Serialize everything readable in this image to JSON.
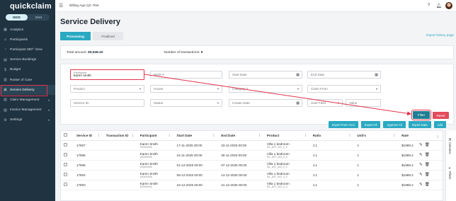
{
  "sidebar": {
    "brand": "quickclaim",
    "toggle": [
      "NDIS",
      "SAH"
    ],
    "items": [
      {
        "label": "Analytics",
        "icon": "analytics-icon",
        "glyph": "▦"
      },
      {
        "label": "Participants",
        "icon": "participants-icon",
        "glyph": "☺"
      },
      {
        "label": "Participant 360° View",
        "icon": "participant-360-icon",
        "glyph": "◔"
      },
      {
        "label": "Service Bookings",
        "icon": "bookings-icon",
        "glyph": "▤"
      },
      {
        "label": "Budget",
        "icon": "budget-icon",
        "glyph": "$"
      },
      {
        "label": "Roster of Care",
        "icon": "roster-icon",
        "glyph": "▥"
      },
      {
        "label": "Service Delivery",
        "icon": "service-delivery-icon",
        "glyph": "▣"
      },
      {
        "label": "Claim Management",
        "icon": "claim-icon",
        "glyph": "▧"
      },
      {
        "label": "Invoice Management",
        "icon": "invoice-icon",
        "glyph": "▨"
      },
      {
        "label": "Settings",
        "icon": "settings-icon",
        "glyph": "⚙"
      }
    ]
  },
  "topbar": {
    "app_title": "Billing App QC-Test"
  },
  "page": {
    "title": "Service Delivery",
    "tabs": [
      "Processing",
      "Finalized"
    ],
    "export_link": "Import history page"
  },
  "summary": {
    "total_label": "Total amount:",
    "total_value": "$9,948.40",
    "count_label": "Number of transactions:",
    "count_value": "5"
  },
  "filters": {
    "participant_label": "Participant",
    "participant_value": "karen smith",
    "ndis_placeholder": "NDIS #",
    "start_date": "Start Date",
    "end_date": "End Date",
    "product": "Product",
    "house": "House",
    "category": "Category 7",
    "claim_from": "Claim From",
    "service_id": "Service ID",
    "status": "Status",
    "create_date": "Create Date",
    "user_field": "User Field",
    "value": "Value",
    "filter_btn": "Filter",
    "reset_btn": "Reset"
  },
  "actions": [
    "Import From XLS",
    "Export All",
    "Approve All",
    "Import Data",
    "Add"
  ],
  "table": {
    "columns": [
      "Service ID",
      "Transaction ID",
      "Participant",
      "Start Date",
      "End Date",
      "Product",
      "Ratio",
      "Unit's",
      "Rate"
    ],
    "rows": [
      {
        "service_id": "17807",
        "transaction_id": "",
        "participant": "Karen Smith",
        "participant_sub": "430000006",
        "start": "17-11-2025 00:00",
        "end": "23-11-2025 00:00",
        "product": "Villa 1 bedroom",
        "product_sub": "SIL_AST_002_0_3",
        "ratio": "1:1",
        "units": "1",
        "rate": "$1989.2"
      },
      {
        "service_id": "17806",
        "transaction_id": "",
        "participant": "Karen Smith",
        "participant_sub": "430000006",
        "start": "24-11-2025 00:00",
        "end": "30-11-2025 00:00",
        "product": "Villa 1 bedroom",
        "product_sub": "SIL_AST_002_0_3",
        "ratio": "1:1",
        "units": "1",
        "rate": "$1989.2"
      },
      {
        "service_id": "17805",
        "transaction_id": "",
        "participant": "Karen Smith",
        "participant_sub": "430000006",
        "start": "01-12-2025 00:00",
        "end": "07-12-2025 00:00",
        "product": "Villa 1 bedroom",
        "product_sub": "SIL_AST_002_0_3",
        "ratio": "1:1",
        "units": "1",
        "rate": "$1989.2"
      },
      {
        "service_id": "17804",
        "transaction_id": "",
        "participant": "Karen Smith",
        "participant_sub": "430000006",
        "start": "08-12-2025 00:00",
        "end": "14-12-2025 00:00",
        "product": "Villa 1 bedroom",
        "product_sub": "SIL_AST_002_0_3",
        "ratio": "1:1",
        "units": "1",
        "rate": "$1989.2"
      },
      {
        "service_id": "17803",
        "transaction_id": "",
        "participant": "Karen Smith",
        "participant_sub": "430000006",
        "start": "15-12-2025 00:00",
        "end": "21-12-2025 00:00",
        "product": "Villa 1 bedroom",
        "product_sub": "SIL_AST_002_0_3",
        "ratio": "1:1",
        "units": "1",
        "rate": "$1989.2"
      }
    ]
  },
  "rail": [
    "Columns",
    "Filters"
  ],
  "colors": {
    "accent": "#2aa9c2",
    "sidebar": "#1f3341",
    "highlight": "#e0334d"
  }
}
